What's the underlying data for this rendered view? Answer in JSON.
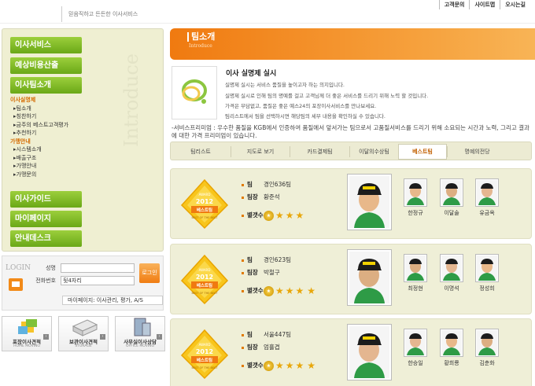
{
  "header": {
    "slogan": "믿음직하고 든든한 이사서비스",
    "links": [
      "고객문의",
      "사이트맵",
      "오시는길"
    ]
  },
  "sidebar": {
    "menu": [
      {
        "label": "이사서비스"
      },
      {
        "label": "예상비용산출"
      },
      {
        "label": "이사팀소개"
      }
    ],
    "sub_items": [
      {
        "label": "이사실명제",
        "selected": true,
        "sub": false
      },
      {
        "label": "팀소개",
        "selected": false,
        "sub": true
      },
      {
        "label": "칭찬하기",
        "selected": false,
        "sub": true
      },
      {
        "label": "금주의 베스트고객평가",
        "selected": false,
        "sub": true
      },
      {
        "label": "추천하기",
        "selected": false,
        "sub": true
      },
      {
        "label": "가맹안내",
        "selected": true,
        "sub": false
      },
      {
        "label": "시스템소개",
        "selected": false,
        "sub": true
      },
      {
        "label": "배출구조",
        "selected": false,
        "sub": true
      },
      {
        "label": "가맹안내",
        "selected": false,
        "sub": true
      },
      {
        "label": "가맹문의",
        "selected": false,
        "sub": true
      }
    ],
    "menu_bottom": [
      {
        "label": "이사가이드"
      },
      {
        "label": "마이페이지"
      },
      {
        "label": "안내데스크"
      }
    ],
    "watermark": "Introduce"
  },
  "login": {
    "title": "LOGIN",
    "name_label": "성명",
    "phone_label": "전화번호",
    "phone_value": "뒷4자리",
    "button": "로그인",
    "mypage": "마이페이지: 이사관리, 평가, A/S"
  },
  "quick": [
    {
      "label": "포장이사견적",
      "en": "HOME MOVING"
    },
    {
      "label": "보관이사견적",
      "en": "STORAGE"
    },
    {
      "label": "사무실이사상담",
      "en": "OFFICE MOVING"
    }
  ],
  "banner": {
    "title": "팀소개",
    "subtitle": "Introduce"
  },
  "intro": {
    "title": "이사 실명제 실시",
    "lines": [
      "실명제 실시는 서비스 품질을 높이고자 하는 의지입니다.",
      "실명제 실시로 인해 팀의 명예를 걸고 고객님께 더 좋은 서비스를 드리기 위해 노력 할 것입니다.",
      "가격은 부담없고, 품질은 좋은 예스24의 포장이사서비스를 만나보세요.",
      "팀리스트에서 팀을 선택하시면 해당팀의 세부 내용을 확인하실 수 있습니다."
    ],
    "service_text": "-서비스프리미엄 : 우수한 품질을 KGB에서 인증하여 품질에서 앞서가는 팀으로서 고품질서비스를 드리기 위해 소요되는 시간과 노력, 그리고 결과에 대한 가격 프리미엄이 있습니다."
  },
  "tabs": [
    "팀리스트",
    "지도로 보기",
    "카드결제팀",
    "이달의수상팀",
    "베스트팀",
    "명예의전당"
  ],
  "active_tab": 4,
  "badge_text": {
    "award": "AWARD",
    "year": "2012",
    "label": "베스트팀",
    "sub": "BEST OF THE BEST"
  },
  "field_labels": {
    "team": "팀",
    "leader": "팀장",
    "stars": "별갯수"
  },
  "teams": [
    {
      "team": "경인636팀",
      "leader": "황준석",
      "star_count": 3,
      "members": [
        "한정규",
        "이달술",
        "유금옥"
      ],
      "two_rows": false
    },
    {
      "team": "경인623팀",
      "leader": "박철구",
      "star_count": 3,
      "members": [
        "최정현",
        "이명석",
        "정성희"
      ],
      "two_rows": true
    },
    {
      "team": "서울447팀",
      "leader": "엄흘겹",
      "star_count": 3,
      "members": [
        "한승일",
        "황희룡",
        "김춘화"
      ],
      "two_rows": true
    }
  ],
  "colors": {
    "accent": "#f07a10",
    "nav_green": "#7bb821",
    "sidebar_bg": "#efefd2",
    "card_bg": "#efefd7"
  }
}
